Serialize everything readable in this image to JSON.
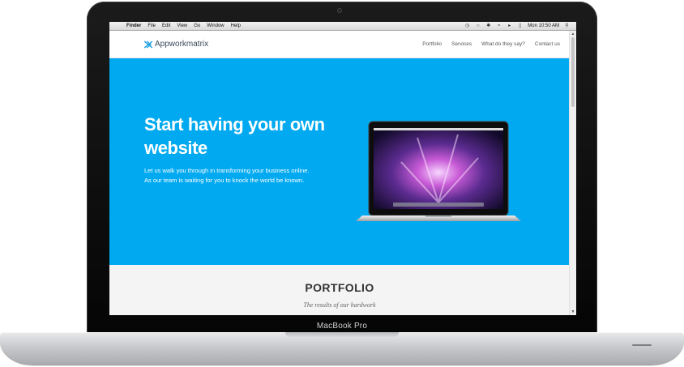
{
  "device": {
    "label": "MacBook Pro"
  },
  "menubar": {
    "apple_glyph": "",
    "menus": [
      "Finder",
      "File",
      "Edit",
      "View",
      "Go",
      "Window",
      "Help"
    ],
    "clock": "Mon 10:50 AM",
    "status_icons": [
      "time-machine-icon",
      "chat-icon",
      "bluetooth-icon",
      "wifi-icon",
      "volume-icon",
      "battery-icon",
      "spotlight-icon"
    ]
  },
  "site": {
    "logo_text": "Appworkmatrix",
    "nav": [
      "Portfolio",
      "Services",
      "What do they say?",
      "Contact us"
    ]
  },
  "hero": {
    "title_line1": "Start having your own",
    "title_line2": "website",
    "subtitle_line1": "Let us walk you through in transforming your business online.",
    "subtitle_line2": "As our team is waiting for you to knock the world be known.",
    "background": "#00a9f0"
  },
  "portfolio": {
    "title": "PORTFOLIO",
    "subtitle": "The results of our hardwork"
  }
}
